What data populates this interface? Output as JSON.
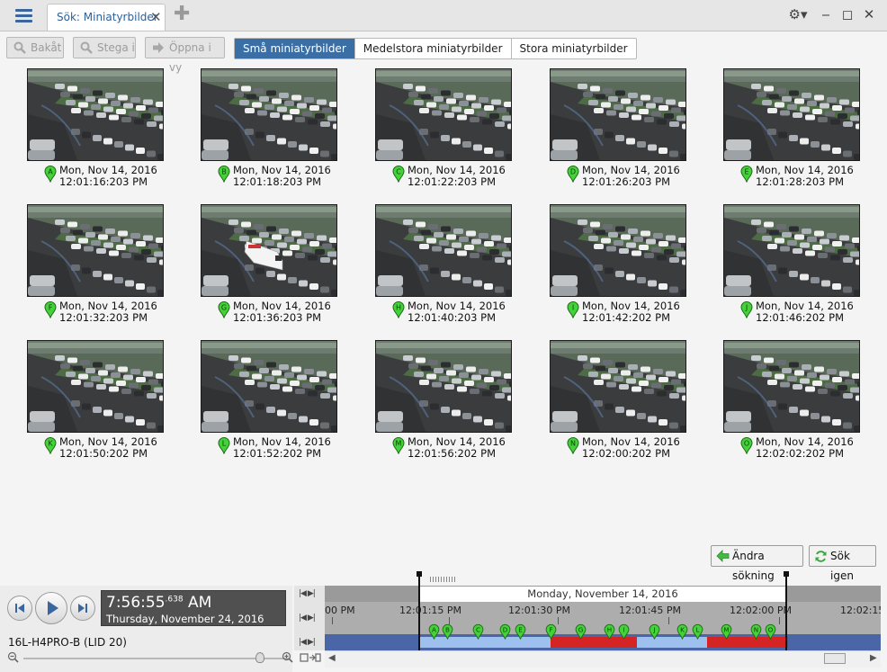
{
  "tab": {
    "title": "Sök: Miniatyrbilder",
    "close": "✕",
    "add": "✚"
  },
  "window_controls": {
    "settings": "⚙▾",
    "minimize": "‒",
    "maximize": "◻",
    "close": "✕"
  },
  "toolbar": {
    "back": "Bakåt",
    "step": "Stega i",
    "open_in_view": "Öppna i vy",
    "sizes": [
      "Små miniatyrbilder",
      "Medelstora miniatyrbilder",
      "Stora miniatyrbilder"
    ],
    "active_size": 0
  },
  "thumbnails": [
    {
      "letter": "A",
      "date": "Mon, Nov 14, 2016",
      "time": "12:01:16:203 PM"
    },
    {
      "letter": "B",
      "date": "Mon, Nov 14, 2016",
      "time": "12:01:18:203 PM"
    },
    {
      "letter": "C",
      "date": "Mon, Nov 14, 2016",
      "time": "12:01:22:203 PM"
    },
    {
      "letter": "D",
      "date": "Mon, Nov 14, 2016",
      "time": "12:01:26:203 PM"
    },
    {
      "letter": "E",
      "date": "Mon, Nov 14, 2016",
      "time": "12:01:28:203 PM"
    },
    {
      "letter": "F",
      "date": "Mon, Nov 14, 2016",
      "time": "12:01:32:203 PM"
    },
    {
      "letter": "G",
      "date": "Mon, Nov 14, 2016",
      "time": "12:01:36:203 PM",
      "van": true
    },
    {
      "letter": "H",
      "date": "Mon, Nov 14, 2016",
      "time": "12:01:40:203 PM"
    },
    {
      "letter": "I",
      "date": "Mon, Nov 14, 2016",
      "time": "12:01:42:202 PM"
    },
    {
      "letter": "J",
      "date": "Mon, Nov 14, 2016",
      "time": "12:01:46:202 PM"
    },
    {
      "letter": "K",
      "date": "Mon, Nov 14, 2016",
      "time": "12:01:50:202 PM"
    },
    {
      "letter": "L",
      "date": "Mon, Nov 14, 2016",
      "time": "12:01:52:202 PM"
    },
    {
      "letter": "M",
      "date": "Mon, Nov 14, 2016",
      "time": "12:01:56:202 PM"
    },
    {
      "letter": "N",
      "date": "Mon, Nov 14, 2016",
      "time": "12:02:00:202 PM"
    },
    {
      "letter": "O",
      "date": "Mon, Nov 14, 2016",
      "time": "12:02:02:202 PM"
    }
  ],
  "actions": {
    "change_search": "Ändra sökning",
    "search_again": "Sök igen"
  },
  "playback": {
    "time": "7:56:55",
    "ms": ".638",
    "ampm": "AM",
    "date": "Thursday, November 24, 2016",
    "camera": "16L-H4PRO-B (LID 20)"
  },
  "timeline": {
    "date_label": "Monday, November 14, 2016",
    "ticks": [
      "00 PM",
      "12:01:15 PM",
      "12:01:30 PM",
      "12:01:45 PM",
      "12:02:00 PM",
      "12:02:15"
    ],
    "markers": [
      "A",
      "B",
      "C",
      "D",
      "E",
      "F",
      "G",
      "H",
      "I",
      "J",
      "K",
      "L",
      "M",
      "N",
      "O"
    ]
  },
  "colors": {
    "accent": "#3a6ea5",
    "marker_green": "#44d13a",
    "timeline_blue": "#4a66a6",
    "timeline_lightblue": "#9dc0ee",
    "timeline_red": "#d42424"
  }
}
